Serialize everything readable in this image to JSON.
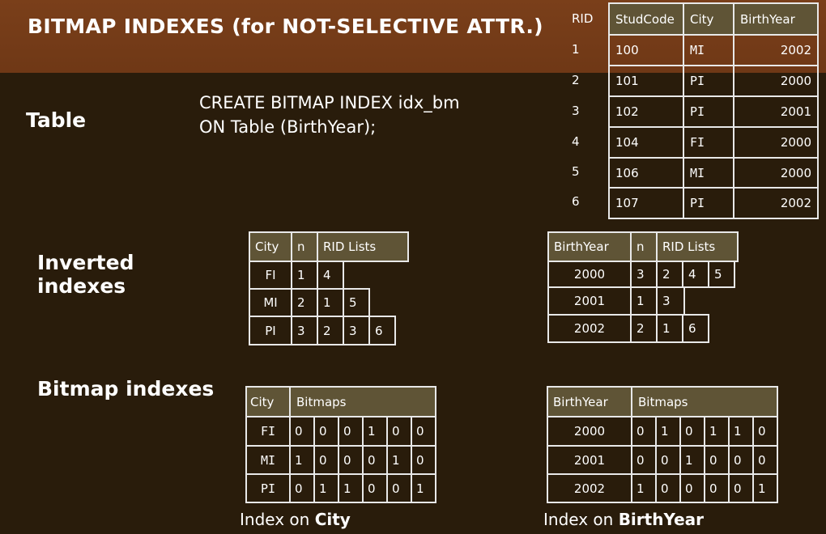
{
  "slide": {
    "title": "BITMAP INDEXES (for NOT-SELECTIVE ATTR.)",
    "table_label": "Table",
    "inverted_label": "Inverted\nindexes",
    "bitmap_label": "Bitmap indexes",
    "sql": "CREATE BITMAP INDEX idx_bm\nON Table (BirthYear);",
    "caption_city_prefix": "Index on ",
    "caption_city_bold": "City",
    "caption_year_prefix": "Index on ",
    "caption_year_bold": "BirthYear"
  },
  "main_table": {
    "rid_header": "RID",
    "headers": [
      "StudCode",
      "City",
      "BirthYear"
    ],
    "rows": [
      {
        "rid": "1",
        "studcode": "100",
        "city": "MI",
        "year": "2002"
      },
      {
        "rid": "2",
        "studcode": "101",
        "city": "PI",
        "year": "2000"
      },
      {
        "rid": "3",
        "studcode": "102",
        "city": "PI",
        "year": "2001"
      },
      {
        "rid": "4",
        "studcode": "104",
        "city": "FI",
        "year": "2000"
      },
      {
        "rid": "5",
        "studcode": "106",
        "city": "MI",
        "year": "2000"
      },
      {
        "rid": "6",
        "studcode": "107",
        "city": "PI",
        "year": "2002"
      }
    ]
  },
  "inverted_city": {
    "headers": [
      "City",
      "n",
      "RID Lists"
    ],
    "rows": [
      {
        "key": "FI",
        "n": "1",
        "rids": [
          "4"
        ]
      },
      {
        "key": "MI",
        "n": "2",
        "rids": [
          "1",
          "5"
        ]
      },
      {
        "key": "PI",
        "n": "3",
        "rids": [
          "2",
          "3",
          "6"
        ]
      }
    ]
  },
  "inverted_year": {
    "headers": [
      "BirthYear",
      "n",
      "RID Lists"
    ],
    "rows": [
      {
        "key": "2000",
        "n": "3",
        "rids": [
          "2",
          "4",
          "5"
        ]
      },
      {
        "key": "2001",
        "n": "1",
        "rids": [
          "3"
        ]
      },
      {
        "key": "2002",
        "n": "2",
        "rids": [
          "1",
          "6"
        ]
      }
    ]
  },
  "bitmap_city": {
    "headers": [
      "City",
      "Bitmaps"
    ],
    "rows": [
      {
        "key": "FI",
        "bits": [
          "0",
          "0",
          "0",
          "1",
          "0",
          "0"
        ]
      },
      {
        "key": "MI",
        "bits": [
          "1",
          "0",
          "0",
          "0",
          "1",
          "0"
        ]
      },
      {
        "key": "PI",
        "bits": [
          "0",
          "1",
          "1",
          "0",
          "0",
          "1"
        ]
      }
    ]
  },
  "bitmap_year": {
    "headers": [
      "BirthYear",
      "Bitmaps"
    ],
    "rows": [
      {
        "key": "2000",
        "bits": [
          "0",
          "1",
          "0",
          "1",
          "1",
          "0"
        ]
      },
      {
        "key": "2001",
        "bits": [
          "0",
          "0",
          "1",
          "0",
          "0",
          "0"
        ]
      },
      {
        "key": "2002",
        "bits": [
          "1",
          "0",
          "0",
          "0",
          "0",
          "1"
        ]
      }
    ]
  }
}
